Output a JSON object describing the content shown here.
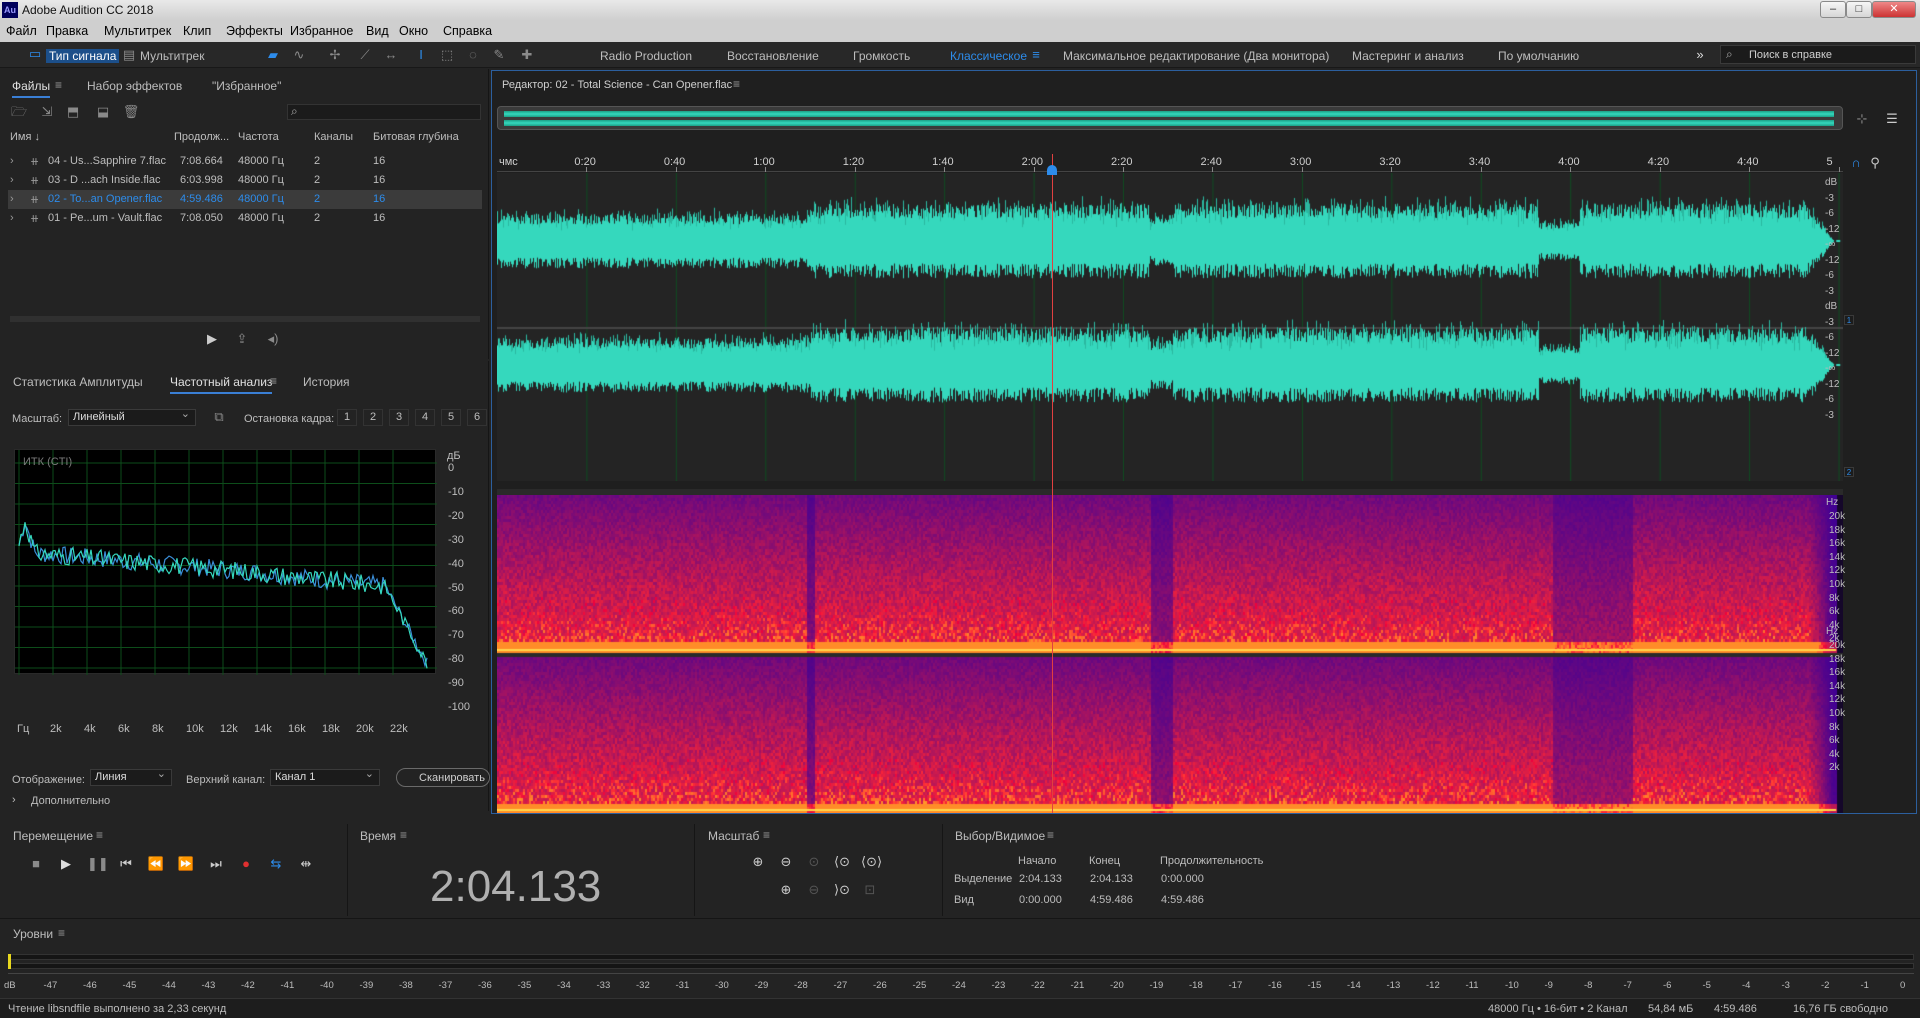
{
  "window": {
    "title": "Adobe Audition CC 2018",
    "logo": "Au"
  },
  "menu": [
    "Файл",
    "Правка",
    "Мультитрек",
    "Клип",
    "Эффекты",
    "Избранное",
    "Вид",
    "Окно",
    "Справка"
  ],
  "toolbar": {
    "waveform_tab": "Тип сигнала",
    "multitrack_tab": "Мультитрек",
    "workspaces": [
      "Radio Production",
      "Восстановление",
      "Громкость",
      "Классическое",
      "Максимальное редактирование (Два монитора)",
      "Мастеринг и анализ",
      "По умолчанию"
    ],
    "active_workspace": "Классическое",
    "search_placeholder": "Поиск в справке"
  },
  "files_panel": {
    "tabs": [
      "Файлы",
      "Набор эффектов",
      "\"Избранное\""
    ],
    "columns": [
      "Имя ↓",
      "Продолж...",
      "Частота",
      "Каналы",
      "Битовая глубина"
    ],
    "rows": [
      {
        "name": "04 - Us...Sapphire 7.flac",
        "duration": "7:08.664",
        "rate": "48000 Гц",
        "channels": "2",
        "depth": "16"
      },
      {
        "name": "03 - D ...ach Inside.flac",
        "duration": "6:03.998",
        "rate": "48000 Гц",
        "channels": "2",
        "depth": "16"
      },
      {
        "name": "02 - To...an Opener.flac",
        "duration": "4:59.486",
        "rate": "48000 Гц",
        "channels": "2",
        "depth": "16"
      },
      {
        "name": "01 - Pe...um - Vault.flac",
        "duration": "7:08.050",
        "rate": "48000 Гц",
        "channels": "2",
        "depth": "16"
      }
    ],
    "selected_row": 2,
    "search_icon": "search-icon"
  },
  "analysis_panel": {
    "tabs": [
      "Статистика Амплитуды",
      "Частотный анализ",
      "История"
    ],
    "scale_label": "Масштаб:",
    "scale_value": "Линейный",
    "freeze_label": "Остановка кадра:",
    "freeze_buttons": [
      "1",
      "2",
      "3",
      "4",
      "5",
      "6"
    ],
    "freeze_colors": [
      "#e03030",
      "#f08a1e",
      "#e8d81e",
      "#58c23a",
      "#3db3d9",
      "#1ec8ff"
    ],
    "graph_label": "ИТК (CTI)",
    "db_unit": "дБ",
    "db_ticks": [
      "0",
      "-10",
      "-20",
      "-30",
      "-40",
      "-50",
      "-60",
      "-70",
      "-80",
      "-90",
      "-100"
    ],
    "hz_ticks": [
      "Гц",
      "2k",
      "4k",
      "6k",
      "8k",
      "10k",
      "12k",
      "14k",
      "16k",
      "18k",
      "20k",
      "22k"
    ],
    "display_label": "Отображение:",
    "display_value": "Линия",
    "upper_channel_label": "Верхний канал:",
    "upper_channel_value": "Канал 1",
    "scan_button": "Сканировать",
    "advanced": "Дополнительно"
  },
  "editor": {
    "title": "Редактор: 02 - Total Science - Can Opener.flac",
    "ruler_unit": "чмс",
    "ruler_ticks": [
      "0:20",
      "0:40",
      "1:00",
      "1:20",
      "1:40",
      "2:00",
      "2:20",
      "2:40",
      "3:00",
      "3:20",
      "3:40",
      "4:00",
      "4:20",
      "4:40",
      "5"
    ],
    "playhead_time": 124.133,
    "total_time": 299.486,
    "db_labels_ch": [
      "dB",
      "-3",
      "-6",
      "-12",
      "-∞",
      "-12",
      "-6",
      "-3"
    ],
    "channel_badges": [
      "1",
      "2"
    ],
    "hz_unit": "Hz",
    "hz_labels": [
      "20k",
      "18k",
      "16k",
      "14k",
      "12k",
      "10k",
      "8k",
      "6k",
      "4k",
      "2k"
    ]
  },
  "transport": {
    "title": "Перемещение"
  },
  "time_panel": {
    "title": "Время",
    "value": "2:04.133"
  },
  "zoom_panel": {
    "title": "Масштаб"
  },
  "selection_panel": {
    "title": "Выбор/Видимое",
    "headers": [
      "Начало",
      "Конец",
      "Продолжительность"
    ],
    "rows": [
      {
        "label": "Выделение",
        "start": "2:04.133",
        "end": "2:04.133",
        "dur": "0:00.000"
      },
      {
        "label": "Вид",
        "start": "0:00.000",
        "end": "4:59.486",
        "dur": "4:59.486"
      }
    ]
  },
  "levels_panel": {
    "title": "Уровни",
    "scale": [
      "dB",
      "-47",
      "-46",
      "-45",
      "-44",
      "-43",
      "-42",
      "-41",
      "-40",
      "-39",
      "-38",
      "-37",
      "-36",
      "-35",
      "-34",
      "-33",
      "-32",
      "-31",
      "-30",
      "-29",
      "-28",
      "-27",
      "-26",
      "-25",
      "-24",
      "-23",
      "-22",
      "-21",
      "-20",
      "-19",
      "-18",
      "-17",
      "-16",
      "-15",
      "-14",
      "-13",
      "-12",
      "-11",
      "-10",
      "-9",
      "-8",
      "-7",
      "-6",
      "-5",
      "-4",
      "-3",
      "-2",
      "-1",
      "0"
    ]
  },
  "status": {
    "message": "Чтение libsndfile выполнено за 2,33 секунд",
    "format": "48000 Гц • 16-бит • 2 Канал",
    "size": "54,84 мБ",
    "duration": "4:59.486",
    "free": "16,76 ГБ свободно"
  }
}
